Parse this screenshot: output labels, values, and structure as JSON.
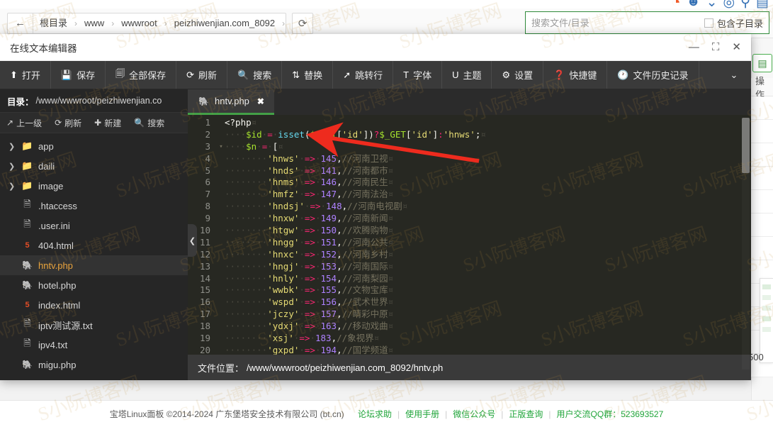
{
  "breadcrumb": {
    "back_icon": "arrow-left-icon",
    "items": [
      "根目录",
      "www",
      "wwwroot",
      "peizhiwenjian.com_8092"
    ],
    "separator": "›",
    "reload_icon": "refresh-icon"
  },
  "search": {
    "placeholder": "搜索文件/目录",
    "value": "",
    "subdir_label": "包含子目录",
    "subdir_checked": false
  },
  "browser_icons": [
    "orange-circle-icon",
    "smile-icon",
    "shield-icon",
    "bookmark-icon"
  ],
  "dialog": {
    "title": "在线文本编辑器",
    "minimize_icon": "minimize-icon",
    "maximize_icon": "maximize-icon",
    "close_icon": "close-icon",
    "toolbar": [
      {
        "icon": "upload-icon",
        "label": "打开"
      },
      {
        "icon": "save-icon",
        "label": "保存"
      },
      {
        "icon": "save-all-icon",
        "label": "全部保存"
      },
      {
        "icon": "refresh-icon",
        "label": "刷新"
      },
      {
        "icon": "search-icon",
        "label": "搜索"
      },
      {
        "icon": "replace-icon",
        "label": "替换"
      },
      {
        "icon": "goto-icon",
        "label": "跳转行"
      },
      {
        "icon": "font-icon",
        "label": "字体"
      },
      {
        "icon": "theme-icon",
        "label": "主题"
      },
      {
        "icon": "gear-icon",
        "label": "设置"
      },
      {
        "icon": "help-icon",
        "label": "快捷键"
      },
      {
        "icon": "clock-icon",
        "label": "文件历史记录"
      }
    ],
    "toolbar_more_icon": "chevron-down-icon"
  },
  "filepanel": {
    "dir_label": "目录：",
    "dir_path": "/www/wwwroot/peizhiwenjian.co",
    "ops": [
      {
        "icon": "arrow-up-icon",
        "label": "上一级"
      },
      {
        "icon": "refresh-icon",
        "label": "刷新"
      },
      {
        "icon": "plus-icon",
        "label": "新建"
      },
      {
        "icon": "search-icon",
        "label": "搜索"
      }
    ],
    "items": [
      {
        "name": "app",
        "type": "folder",
        "expandable": true,
        "selected": false
      },
      {
        "name": "daili",
        "type": "folder",
        "expandable": true,
        "selected": false
      },
      {
        "name": "image",
        "type": "folder",
        "expandable": true,
        "selected": false
      },
      {
        "name": ".htaccess",
        "type": "file",
        "expandable": false,
        "selected": false
      },
      {
        "name": ".user.ini",
        "type": "file",
        "expandable": false,
        "selected": false
      },
      {
        "name": "404.html",
        "type": "html",
        "expandable": false,
        "selected": false
      },
      {
        "name": "hntv.php",
        "type": "php",
        "expandable": false,
        "selected": true
      },
      {
        "name": "hotel.php",
        "type": "php",
        "expandable": false,
        "selected": false
      },
      {
        "name": "index.html",
        "type": "html",
        "expandable": false,
        "selected": false
      },
      {
        "name": "iptv测试源.txt",
        "type": "file",
        "expandable": false,
        "selected": false
      },
      {
        "name": "ipv4.txt",
        "type": "file",
        "expandable": false,
        "selected": false
      },
      {
        "name": "migu.php",
        "type": "php",
        "expandable": false,
        "selected": false
      }
    ],
    "collapse_icon": "chevron-left-icon"
  },
  "editor": {
    "tab": {
      "icon": "php-icon",
      "label": "hntv.php",
      "close_icon": "close-icon"
    },
    "lines": [
      {
        "n": 1,
        "fold": "",
        "parts": [
          {
            "t": "tag",
            "v": "<?php"
          },
          {
            "t": "eol",
            "v": "¤"
          }
        ]
      },
      {
        "n": 2,
        "fold": "",
        "parts": [
          {
            "t": "ws",
            "v": "····"
          },
          {
            "t": "var",
            "v": "$id"
          },
          {
            "t": "ws",
            "v": "·"
          },
          {
            "t": "op",
            "v": "="
          },
          {
            "t": "ws",
            "v": "·"
          },
          {
            "t": "fn",
            "v": "isset"
          },
          {
            "t": "pun",
            "v": "("
          },
          {
            "t": "var",
            "v": "$_GET"
          },
          {
            "t": "pun",
            "v": "["
          },
          {
            "t": "str",
            "v": "'id'"
          },
          {
            "t": "pun",
            "v": "])"
          },
          {
            "t": "op",
            "v": "?"
          },
          {
            "t": "var",
            "v": "$_GET"
          },
          {
            "t": "pun",
            "v": "["
          },
          {
            "t": "str",
            "v": "'id'"
          },
          {
            "t": "pun",
            "v": "]"
          },
          {
            "t": "op",
            "v": ":"
          },
          {
            "t": "str",
            "v": "'hnws'"
          },
          {
            "t": "pun",
            "v": ";"
          },
          {
            "t": "eol",
            "v": "¤"
          }
        ]
      },
      {
        "n": 3,
        "fold": "▾",
        "parts": [
          {
            "t": "ws",
            "v": "····"
          },
          {
            "t": "var",
            "v": "$n"
          },
          {
            "t": "ws",
            "v": "·"
          },
          {
            "t": "op",
            "v": "="
          },
          {
            "t": "ws",
            "v": "·"
          },
          {
            "t": "pun",
            "v": "["
          },
          {
            "t": "eol",
            "v": "¤"
          }
        ]
      },
      {
        "n": 4,
        "fold": "",
        "parts": [
          {
            "t": "ws",
            "v": "········"
          },
          {
            "t": "str",
            "v": "'hnws'"
          },
          {
            "t": "ws",
            "v": "·"
          },
          {
            "t": "op",
            "v": "=>"
          },
          {
            "t": "ws",
            "v": "·"
          },
          {
            "t": "num",
            "v": "145"
          },
          {
            "t": "pun",
            "v": ","
          },
          {
            "t": "com",
            "v": "//河南卫视"
          },
          {
            "t": "eol",
            "v": "¤"
          }
        ]
      },
      {
        "n": 5,
        "fold": "",
        "parts": [
          {
            "t": "ws",
            "v": "········"
          },
          {
            "t": "str",
            "v": "'hnds'"
          },
          {
            "t": "ws",
            "v": "·"
          },
          {
            "t": "op",
            "v": "=>"
          },
          {
            "t": "ws",
            "v": "·"
          },
          {
            "t": "num",
            "v": "141"
          },
          {
            "t": "pun",
            "v": ","
          },
          {
            "t": "com",
            "v": "//河南都市"
          },
          {
            "t": "eol",
            "v": "¤"
          }
        ]
      },
      {
        "n": 6,
        "fold": "",
        "parts": [
          {
            "t": "ws",
            "v": "········"
          },
          {
            "t": "str",
            "v": "'hnms'"
          },
          {
            "t": "ws",
            "v": "·"
          },
          {
            "t": "op",
            "v": "=>"
          },
          {
            "t": "ws",
            "v": "·"
          },
          {
            "t": "num",
            "v": "146"
          },
          {
            "t": "pun",
            "v": ","
          },
          {
            "t": "com",
            "v": "//河南民生"
          },
          {
            "t": "eol",
            "v": "¤"
          }
        ]
      },
      {
        "n": 7,
        "fold": "",
        "parts": [
          {
            "t": "ws",
            "v": "········"
          },
          {
            "t": "str",
            "v": "'hmfz'"
          },
          {
            "t": "ws",
            "v": "·"
          },
          {
            "t": "op",
            "v": "=>"
          },
          {
            "t": "ws",
            "v": "·"
          },
          {
            "t": "num",
            "v": "147"
          },
          {
            "t": "pun",
            "v": ","
          },
          {
            "t": "com",
            "v": "//河南法治"
          },
          {
            "t": "eol",
            "v": "¤"
          }
        ]
      },
      {
        "n": 8,
        "fold": "",
        "parts": [
          {
            "t": "ws",
            "v": "········"
          },
          {
            "t": "str",
            "v": "'hndsj'"
          },
          {
            "t": "ws",
            "v": "·"
          },
          {
            "t": "op",
            "v": "=>"
          },
          {
            "t": "ws",
            "v": "·"
          },
          {
            "t": "num",
            "v": "148"
          },
          {
            "t": "pun",
            "v": ","
          },
          {
            "t": "com",
            "v": "//河南电视剧"
          },
          {
            "t": "eol",
            "v": "¤"
          }
        ]
      },
      {
        "n": 9,
        "fold": "",
        "parts": [
          {
            "t": "ws",
            "v": "········"
          },
          {
            "t": "str",
            "v": "'hnxw'"
          },
          {
            "t": "ws",
            "v": "·"
          },
          {
            "t": "op",
            "v": "=>"
          },
          {
            "t": "ws",
            "v": "·"
          },
          {
            "t": "num",
            "v": "149"
          },
          {
            "t": "pun",
            "v": ","
          },
          {
            "t": "com",
            "v": "//河南新闻"
          },
          {
            "t": "eol",
            "v": "¤"
          }
        ]
      },
      {
        "n": 10,
        "fold": "",
        "parts": [
          {
            "t": "ws",
            "v": "········"
          },
          {
            "t": "str",
            "v": "'htgw'"
          },
          {
            "t": "ws",
            "v": "·"
          },
          {
            "t": "op",
            "v": "=>"
          },
          {
            "t": "ws",
            "v": "·"
          },
          {
            "t": "num",
            "v": "150"
          },
          {
            "t": "pun",
            "v": ","
          },
          {
            "t": "com",
            "v": "//欢腾购物"
          },
          {
            "t": "eol",
            "v": "¤"
          }
        ]
      },
      {
        "n": 11,
        "fold": "",
        "parts": [
          {
            "t": "ws",
            "v": "········"
          },
          {
            "t": "str",
            "v": "'hngg'"
          },
          {
            "t": "ws",
            "v": "·"
          },
          {
            "t": "op",
            "v": "=>"
          },
          {
            "t": "ws",
            "v": "·"
          },
          {
            "t": "num",
            "v": "151"
          },
          {
            "t": "pun",
            "v": ","
          },
          {
            "t": "com",
            "v": "//河南公共"
          },
          {
            "t": "eol",
            "v": "¤"
          }
        ]
      },
      {
        "n": 12,
        "fold": "",
        "parts": [
          {
            "t": "ws",
            "v": "········"
          },
          {
            "t": "str",
            "v": "'hnxc'"
          },
          {
            "t": "ws",
            "v": "·"
          },
          {
            "t": "op",
            "v": "=>"
          },
          {
            "t": "ws",
            "v": "·"
          },
          {
            "t": "num",
            "v": "152"
          },
          {
            "t": "pun",
            "v": ","
          },
          {
            "t": "com",
            "v": "//河南乡村"
          },
          {
            "t": "eol",
            "v": "¤"
          }
        ]
      },
      {
        "n": 13,
        "fold": "",
        "parts": [
          {
            "t": "ws",
            "v": "········"
          },
          {
            "t": "str",
            "v": "'hngj'"
          },
          {
            "t": "ws",
            "v": "·"
          },
          {
            "t": "op",
            "v": "=>"
          },
          {
            "t": "ws",
            "v": "·"
          },
          {
            "t": "num",
            "v": "153"
          },
          {
            "t": "pun",
            "v": ","
          },
          {
            "t": "com",
            "v": "//河南国际"
          },
          {
            "t": "eol",
            "v": "¤"
          }
        ]
      },
      {
        "n": 14,
        "fold": "",
        "parts": [
          {
            "t": "ws",
            "v": "········"
          },
          {
            "t": "str",
            "v": "'hnly'"
          },
          {
            "t": "ws",
            "v": "·"
          },
          {
            "t": "op",
            "v": "=>"
          },
          {
            "t": "ws",
            "v": "·"
          },
          {
            "t": "num",
            "v": "154"
          },
          {
            "t": "pun",
            "v": ","
          },
          {
            "t": "com",
            "v": "//河南梨园"
          },
          {
            "t": "eol",
            "v": "¤"
          }
        ]
      },
      {
        "n": 15,
        "fold": "",
        "parts": [
          {
            "t": "ws",
            "v": "········"
          },
          {
            "t": "str",
            "v": "'wwbk'"
          },
          {
            "t": "ws",
            "v": "·"
          },
          {
            "t": "op",
            "v": "=>"
          },
          {
            "t": "ws",
            "v": "·"
          },
          {
            "t": "num",
            "v": "155"
          },
          {
            "t": "pun",
            "v": ","
          },
          {
            "t": "com",
            "v": "//文物宝库"
          },
          {
            "t": "eol",
            "v": "¤"
          }
        ]
      },
      {
        "n": 16,
        "fold": "",
        "parts": [
          {
            "t": "ws",
            "v": "········"
          },
          {
            "t": "str",
            "v": "'wspd'"
          },
          {
            "t": "ws",
            "v": "·"
          },
          {
            "t": "op",
            "v": "=>"
          },
          {
            "t": "ws",
            "v": "·"
          },
          {
            "t": "num",
            "v": "156"
          },
          {
            "t": "pun",
            "v": ","
          },
          {
            "t": "com",
            "v": "//武术世界"
          },
          {
            "t": "eol",
            "v": "¤"
          }
        ]
      },
      {
        "n": 17,
        "fold": "",
        "parts": [
          {
            "t": "ws",
            "v": "········"
          },
          {
            "t": "str",
            "v": "'jczy'"
          },
          {
            "t": "ws",
            "v": "·"
          },
          {
            "t": "op",
            "v": "=>"
          },
          {
            "t": "ws",
            "v": "·"
          },
          {
            "t": "num",
            "v": "157"
          },
          {
            "t": "pun",
            "v": ","
          },
          {
            "t": "com",
            "v": "//睛彩中原"
          },
          {
            "t": "eol",
            "v": "¤"
          }
        ]
      },
      {
        "n": 18,
        "fold": "",
        "parts": [
          {
            "t": "ws",
            "v": "········"
          },
          {
            "t": "str",
            "v": "'ydxj'"
          },
          {
            "t": "ws",
            "v": "·"
          },
          {
            "t": "op",
            "v": "=>"
          },
          {
            "t": "ws",
            "v": "·"
          },
          {
            "t": "num",
            "v": "163"
          },
          {
            "t": "pun",
            "v": ","
          },
          {
            "t": "com",
            "v": "//移动戏曲"
          },
          {
            "t": "eol",
            "v": "¤"
          }
        ]
      },
      {
        "n": 19,
        "fold": "",
        "parts": [
          {
            "t": "ws",
            "v": "········"
          },
          {
            "t": "str",
            "v": "'xsj'"
          },
          {
            "t": "ws",
            "v": "·"
          },
          {
            "t": "op",
            "v": "=>"
          },
          {
            "t": "ws",
            "v": "·"
          },
          {
            "t": "num",
            "v": "183"
          },
          {
            "t": "pun",
            "v": ","
          },
          {
            "t": "com",
            "v": "//象视界"
          },
          {
            "t": "eol",
            "v": "¤"
          }
        ]
      },
      {
        "n": 20,
        "fold": "",
        "parts": [
          {
            "t": "ws",
            "v": "········"
          },
          {
            "t": "str",
            "v": "'gxpd'"
          },
          {
            "t": "ws",
            "v": "·"
          },
          {
            "t": "op",
            "v": "=>"
          },
          {
            "t": "ws",
            "v": "·"
          },
          {
            "t": "num",
            "v": "194"
          },
          {
            "t": "pun",
            "v": ","
          },
          {
            "t": "com",
            "v": "//国学频道"
          },
          {
            "t": "eol",
            "v": "¤"
          }
        ]
      }
    ],
    "location_label": "文件位置：",
    "location_path": "/www/wwwroot/peizhiwenjian.com_8092/hntv.ph"
  },
  "background": {
    "list_icon": "list-view-icon",
    "column_header": "操作",
    "value_500": "500"
  },
  "footer": {
    "copyright": "宝塔Linux面板 ©2014-2024 广东堡塔安全技术有限公司 (bt.cn)",
    "links": [
      "论坛求助",
      "使用手册",
      "微信公众号",
      "正版查询"
    ],
    "qq": "用户交流QQ群：523693527"
  },
  "annotation": {
    "arrow_color": "#ee2b1e"
  },
  "watermark_text": "S小阮博客网"
}
